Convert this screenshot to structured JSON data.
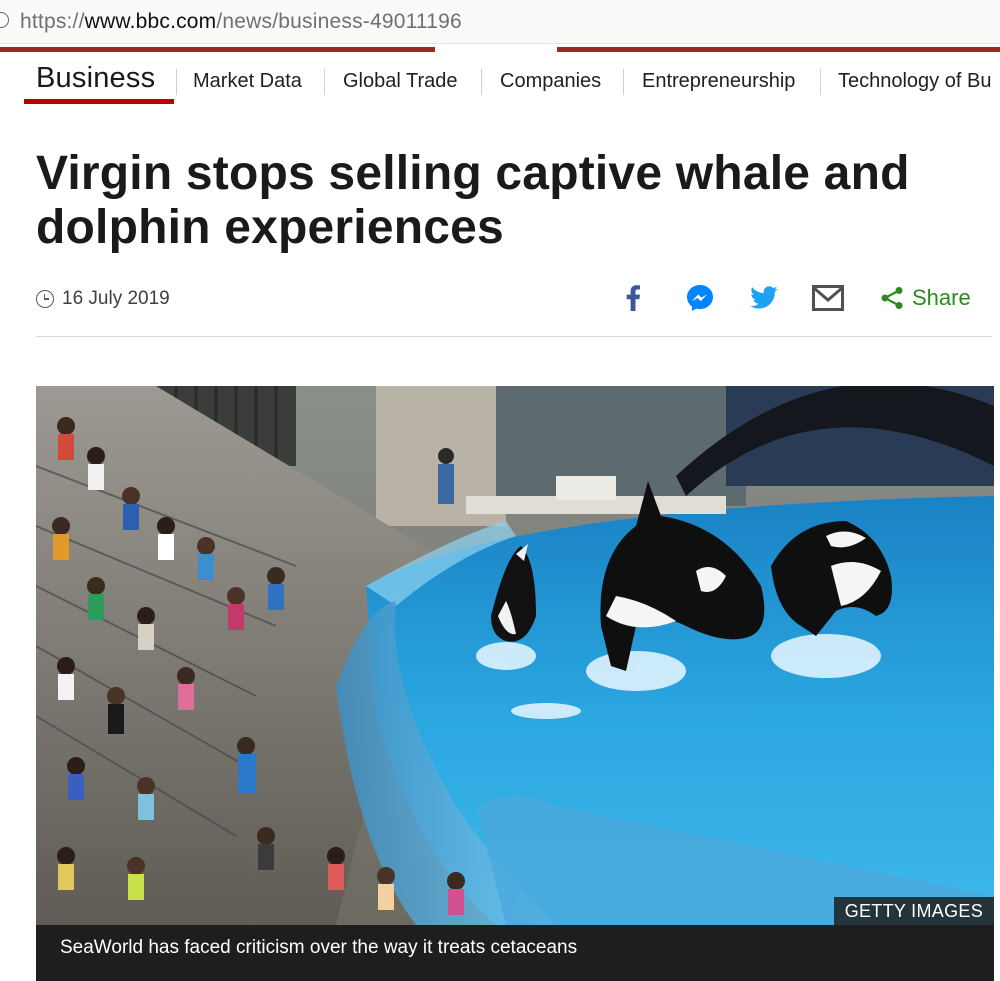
{
  "browser": {
    "url_scheme": "https://",
    "url_host": "www.bbc.com",
    "url_path": "/news/business-49011196"
  },
  "nav": {
    "brand": "Business",
    "items": [
      "Market Data",
      "Global Trade",
      "Companies",
      "Entrepreneurship",
      "Technology of Bu"
    ]
  },
  "article": {
    "headline": "Virgin stops selling captive whale and dolphin experiences",
    "date": "16 July 2019",
    "share_label": "Share",
    "image_credit": "GETTY IMAGES",
    "image_caption": "SeaWorld has faced criticism over the way it treats cetaceans"
  },
  "colors": {
    "accent_red": "#b80000",
    "share_green": "#2b8a1e",
    "facebook": "#3b5998",
    "messenger": "#0084ff",
    "twitter": "#1da1f2"
  },
  "icons": {
    "date": "clock-icon",
    "share": [
      "facebook-icon",
      "messenger-icon",
      "twitter-icon",
      "email-icon",
      "share-icon"
    ]
  }
}
